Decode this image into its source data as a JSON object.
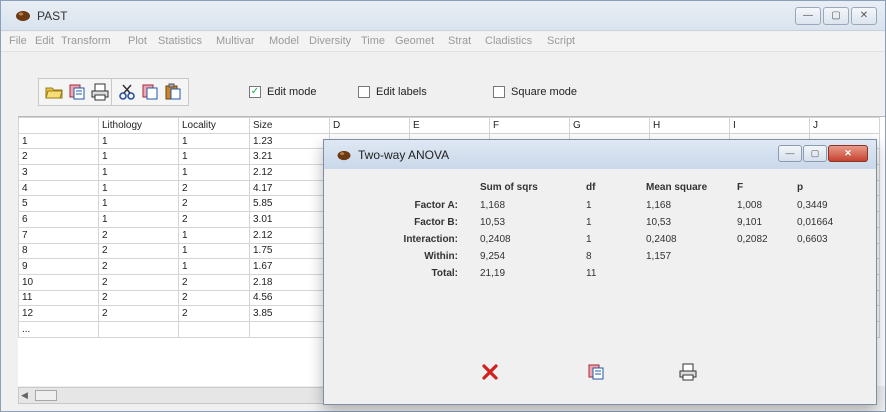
{
  "app": {
    "title": "PAST"
  },
  "window_buttons": [
    "—",
    "▢",
    "✕"
  ],
  "menu": [
    "File",
    "Edit",
    "Transform",
    "Plot",
    "Statistics",
    "Multivar",
    "Model",
    "Diversity",
    "Time",
    "Geomet",
    "Strat",
    "Cladistics",
    "Script"
  ],
  "toolbar": {
    "edit_mode": {
      "label": "Edit mode",
      "checked": true
    },
    "edit_labels": {
      "label": "Edit labels",
      "checked": false
    },
    "square_mode": {
      "label": "Square mode",
      "checked": false
    }
  },
  "spreadsheet": {
    "columns": [
      "Lithology",
      "Locality",
      "Size",
      "D",
      "E",
      "F",
      "G",
      "H",
      "I",
      "J"
    ],
    "rows": [
      {
        "label": "1",
        "cells": [
          "1",
          "1",
          "1.23"
        ]
      },
      {
        "label": "2",
        "cells": [
          "1",
          "1",
          "3.21"
        ]
      },
      {
        "label": "3",
        "cells": [
          "1",
          "1",
          "2.12"
        ]
      },
      {
        "label": "4",
        "cells": [
          "1",
          "2",
          "4.17"
        ]
      },
      {
        "label": "5",
        "cells": [
          "1",
          "2",
          "5.85"
        ]
      },
      {
        "label": "6",
        "cells": [
          "1",
          "2",
          "3.01"
        ]
      },
      {
        "label": "7",
        "cells": [
          "2",
          "1",
          "2.12"
        ]
      },
      {
        "label": "8",
        "cells": [
          "2",
          "1",
          "1.75"
        ]
      },
      {
        "label": "9",
        "cells": [
          "2",
          "1",
          "1.67"
        ]
      },
      {
        "label": "10",
        "cells": [
          "2",
          "2",
          "2.18"
        ]
      },
      {
        "label": "11",
        "cells": [
          "2",
          "2",
          "4.56"
        ]
      },
      {
        "label": "12",
        "cells": [
          "2",
          "2",
          "3.85"
        ]
      },
      {
        "label": "...",
        "cells": [
          "",
          "",
          ""
        ]
      }
    ]
  },
  "dialog": {
    "title": "Two-way ANOVA",
    "headers": [
      "Sum of sqrs",
      "df",
      "Mean square",
      "F",
      "p"
    ],
    "rows": [
      {
        "label": "Factor A:",
        "values": [
          "1,168",
          "1",
          "1,168",
          "1,008",
          "0,3449"
        ]
      },
      {
        "label": "Factor B:",
        "values": [
          "10,53",
          "1",
          "10,53",
          "9,101",
          "0,01664"
        ]
      },
      {
        "label": "Interaction:",
        "values": [
          "0,2408",
          "1",
          "0,2408",
          "0,2082",
          "0,6603"
        ]
      },
      {
        "label": "Within:",
        "values": [
          "9,254",
          "8",
          "1,157",
          "",
          ""
        ]
      },
      {
        "label": "Total:",
        "values": [
          "21,19",
          "11",
          "",
          "",
          ""
        ]
      }
    ],
    "actions": [
      "close-red-x-icon",
      "copy-icon",
      "print-icon"
    ]
  },
  "colors": {
    "accent_red": "#d21f1f",
    "checkbox_tick": "#1a8f3c"
  }
}
